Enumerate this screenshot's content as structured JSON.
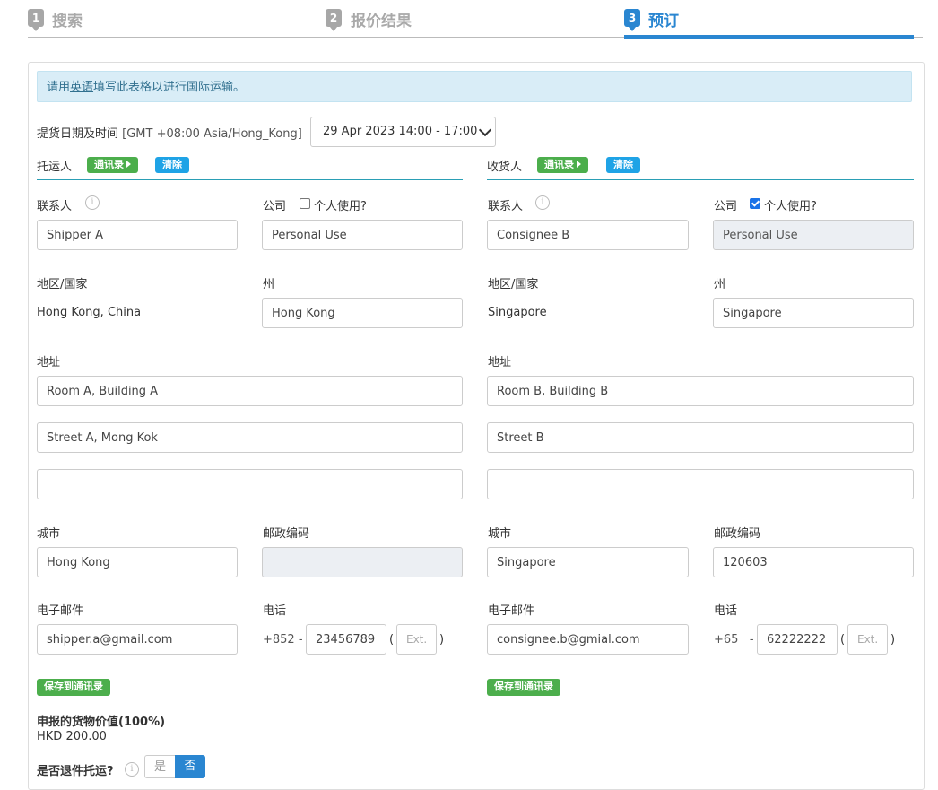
{
  "stepper": {
    "steps": [
      {
        "num": "1",
        "label": "搜索"
      },
      {
        "num": "2",
        "label": "报价结果"
      },
      {
        "num": "3",
        "label": "预订"
      }
    ]
  },
  "notice": {
    "prefix": "请用",
    "link": "英语",
    "suffix": "填写此表格以进行国际运输。"
  },
  "pickup": {
    "label": "提货日期及时间",
    "timezone": "[GMT +08:00 Asia/Hong_Kong]",
    "selected": "29 Apr 2023 14:00 - 17:00"
  },
  "shipper": {
    "title": "托运人",
    "address_book_btn": "通讯录",
    "clear_btn": "清除",
    "contact_label": "联系人",
    "contact": "Shipper A",
    "company_label": "公司",
    "personal_label": "个人使用?",
    "personal_checked": false,
    "company": "Personal Use",
    "region_label": "地区/国家",
    "region": "Hong Kong, China",
    "state_label": "州",
    "state": "Hong Kong",
    "address_label": "地址",
    "address1": "Room A, Building A",
    "address2": "Street A, Mong Kok",
    "address3": "",
    "city_label": "城市",
    "city": "Hong Kong",
    "postal_label": "邮政编码",
    "postal": "",
    "email_label": "电子邮件",
    "email": "shipper.a@gmail.com",
    "phone_label": "电话",
    "phone_code": "+852",
    "phone": "23456789",
    "ext_placeholder": "Ext.",
    "save_btn": "保存到通讯录"
  },
  "consignee": {
    "title": "收货人",
    "address_book_btn": "通讯录",
    "clear_btn": "清除",
    "contact_label": "联系人",
    "contact": "Consignee B",
    "company_label": "公司",
    "personal_label": "个人使用?",
    "personal_checked": true,
    "company": "Personal Use",
    "region_label": "地区/国家",
    "region": "Singapore",
    "state_label": "州",
    "state": "Singapore",
    "address_label": "地址",
    "address1": "Room B, Building B",
    "address2": "Street B",
    "address3": "",
    "city_label": "城市",
    "city": "Singapore",
    "postal_label": "邮政编码",
    "postal": "120603",
    "email_label": "电子邮件",
    "email": "consignee.b@gmial.com",
    "phone_label": "电话",
    "phone_code": "+65",
    "phone": "62222222",
    "ext_placeholder": "Ext.",
    "save_btn": "保存到通讯录"
  },
  "declared": {
    "label": "申报的货物价值(100%)",
    "value": "HKD 200.00"
  },
  "return": {
    "label": "是否退件托运?",
    "yes": "是",
    "no": "否"
  },
  "colors": {
    "accent": "#2a86d1",
    "green": "#4cae4c",
    "light_blue": "#1fa3e6"
  }
}
